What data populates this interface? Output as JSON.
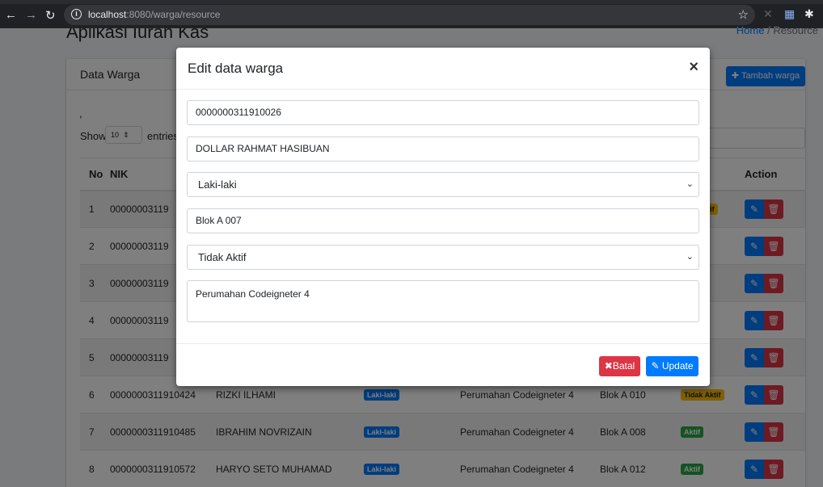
{
  "browser": {
    "url_host": "localhost",
    "url_rest": ":8080/warga/resource"
  },
  "page": {
    "app_title": "Aplikasi Iuran Kas",
    "breadcrumb_home": "Home",
    "breadcrumb_sep": "/",
    "breadcrumb_current": "Resource",
    "card_title": "Data Warga",
    "add_button": "Tambah warga",
    "comma": ",",
    "show_label": "Show",
    "show_value": "10",
    "entries_label": "entries"
  },
  "table": {
    "headers": {
      "no": "No",
      "nik": "NIK",
      "status": "us",
      "action": "Action"
    },
    "rows": [
      {
        "no": "1",
        "nik": "00000003119",
        "nama": "",
        "jk": "",
        "alamat": "",
        "blok": "",
        "status": "dak Aktif",
        "status_type": "tidak"
      },
      {
        "no": "2",
        "nik": "00000003119",
        "nama": "",
        "jk": "",
        "alamat": "",
        "blok": "",
        "status": "",
        "status_type": "aktif"
      },
      {
        "no": "3",
        "nik": "00000003119",
        "nama": "",
        "jk": "",
        "alamat": "",
        "blok": "",
        "status": "k Aktif",
        "status_type": "tidak"
      },
      {
        "no": "4",
        "nik": "00000003119",
        "nama": "",
        "jk": "",
        "alamat": "",
        "blok": "",
        "status": "k Aktif",
        "status_type": "tidak"
      },
      {
        "no": "5",
        "nik": "00000003119",
        "nama": "",
        "jk": "",
        "alamat": "",
        "blok": "",
        "status": "k Aktif",
        "status_type": "tidak"
      },
      {
        "no": "6",
        "nik": "0000000311910424",
        "nama": "RIZKI ILHAMI",
        "jk": "Laki-laki",
        "alamat": "Perumahan Codeigneter 4",
        "blok": "Blok A 010",
        "status": "Tidak Aktif",
        "status_type": "tidak"
      },
      {
        "no": "7",
        "nik": "0000000311910485",
        "nama": "IBRAHIM NOVRIZAIN",
        "jk": "Laki-laki",
        "alamat": "Perumahan Codeigneter 4",
        "blok": "Blok A 008",
        "status": "Aktif",
        "status_type": "aktif"
      },
      {
        "no": "8",
        "nik": "0000000311910572",
        "nama": "HARYO SETO MUHAMAD",
        "jk": "Laki-laki",
        "alamat": "Perumahan Codeigneter 4",
        "blok": "Blok A 012",
        "status": "Aktif",
        "status_type": "aktif"
      }
    ]
  },
  "modal": {
    "title": "Edit data warga",
    "close": "×",
    "nik": "0000000311910026",
    "nama": "DOLLAR RAHMAT HASIBUAN",
    "jenis_kelamin": "Laki-laki",
    "blok": "Blok A 007",
    "status": "Tidak Aktif",
    "alamat": "Perumahan Codeigneter 4",
    "cancel_label": "Batal",
    "update_label": "Update"
  },
  "colors": {
    "primary": "#007bff",
    "danger": "#dc3545",
    "success": "#28a745",
    "warning": "#ffc107"
  }
}
